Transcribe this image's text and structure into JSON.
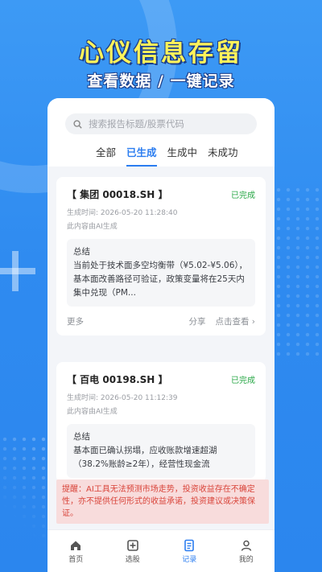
{
  "hero": {
    "title": "心仪信息存留",
    "subtitle": "查看数据 / 一键记录"
  },
  "search": {
    "placeholder": "搜索报告标题/股票代码"
  },
  "tabs": [
    {
      "label": "全部",
      "active": false
    },
    {
      "label": "已生成",
      "active": true
    },
    {
      "label": "生成中",
      "active": false
    },
    {
      "label": "未成功",
      "active": false
    }
  ],
  "cards": [
    {
      "title": "【  集团  00018.SH  】",
      "status": "已完成",
      "time": "生成时间: 2026-05-20 11:28:40",
      "source": "此内容由AI生成",
      "summary_label": "总结",
      "summary": "当前处于技术面多空均衡带（¥5.02-¥5.06），基本面改善路径可验证，政策变量将在25天内集中兑现（PM...",
      "actions": {
        "left": "更多",
        "share": "分享",
        "view": "点击查看 ›"
      }
    },
    {
      "title": "【  百电  00198.SH  】",
      "status": "已完成",
      "time": "生成时间: 2026-05-20 11:12:39",
      "source": "此内容由AI生成",
      "summary_label": "总结",
      "summary": "基本面已确认拐塌，应收账款增速超湖（38.2%账龄≥2年），经营性现金流"
    }
  ],
  "disclaimer": "提醒：AI工具无法预测市场走势，投资收益存在不确定性，亦不提供任何形式的收益承诺，投资建议或决策保证。",
  "nav": [
    {
      "label": "首页",
      "icon": "home-icon",
      "active": false
    },
    {
      "label": "选股",
      "icon": "add-box-icon",
      "active": false
    },
    {
      "label": "记录",
      "icon": "record-icon",
      "active": true
    },
    {
      "label": "我的",
      "icon": "user-icon",
      "active": false
    }
  ],
  "colors": {
    "brand": "#2b7df0",
    "hero_title": "#fff35a",
    "success": "#27a745",
    "warning": "#d9443a"
  }
}
